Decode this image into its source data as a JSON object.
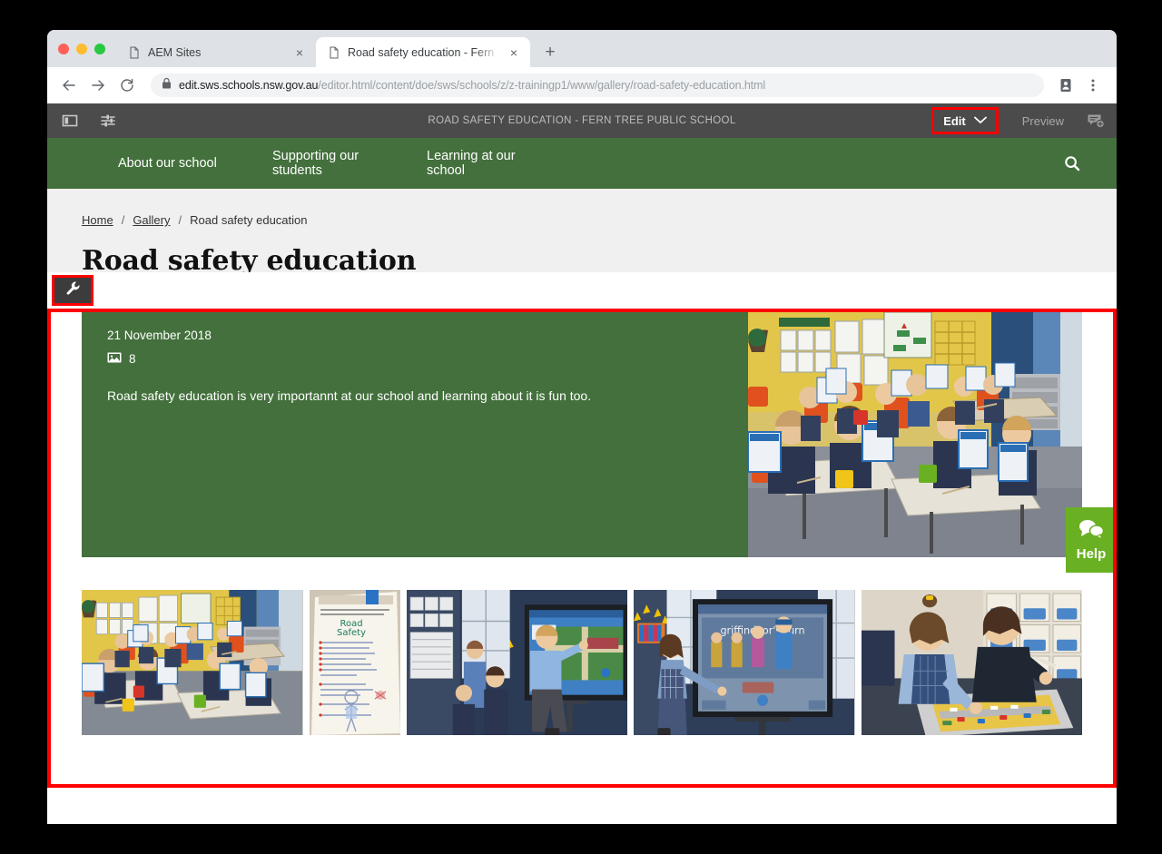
{
  "browser": {
    "tabs": [
      {
        "title": "AEM Sites",
        "active": false,
        "favicon": "page-icon",
        "close": "×"
      },
      {
        "title": "Road safety education - Fern T",
        "active": true,
        "favicon": "page-icon",
        "close": "×"
      }
    ],
    "new_tab_label": "+",
    "back_label": "←",
    "forward_label": "→",
    "reload_label": "C",
    "url_secure_prefix": "https://",
    "url_host": "edit.sws.schools.nsw.gov.au",
    "url_path": "/editor.html/content/doe/sws/schools/z/z-trainingp1/www/gallery/road-safety-education.html",
    "url_full": "https://edit.sws.schools.nsw.gov.au/editor.html/content/doe/sws/schools/z/z-trainingp1/www/gallery/road-safety-education.html",
    "lock_icon": "lock-icon",
    "profile_icon": "profile-card-icon",
    "menu_icon": "kebab-menu-icon"
  },
  "aem_toolbar": {
    "sidebar_toggle_icon": "sidebar-panel-icon",
    "page_info_icon": "page-properties-icon",
    "title": "ROAD SAFETY EDUCATION - FERN TREE PUBLIC SCHOOL",
    "edit_label": "Edit",
    "edit_chevron": "chevron-down-icon",
    "preview_label": "Preview",
    "annotate_icon": "add-annotation-icon",
    "highlight_color": "#ff0000"
  },
  "site_nav": {
    "items": [
      {
        "label": "About our school"
      },
      {
        "label": "Supporting our students"
      },
      {
        "label": "Learning at our school"
      }
    ],
    "search_icon": "search-icon",
    "background": "#43703c"
  },
  "breadcrumb": {
    "items": [
      {
        "label": "Home",
        "link": true
      },
      {
        "label": "Gallery",
        "link": true
      },
      {
        "label": "Road safety education",
        "link": false
      }
    ],
    "separator": "/"
  },
  "page": {
    "title": "Road safety education"
  },
  "component": {
    "wrench_icon": "wrench-icon",
    "selection_color": "#ff0000",
    "edit_bar_color": "#2680eb"
  },
  "gallery": {
    "date": "21 November 2018",
    "image_count": "8",
    "image_count_icon": "image-icon",
    "description": "Road safety education is very importannt at our school and learning about it is fun too.",
    "panel_color": "#43703c",
    "hero_alt": "Students in a classroom holding up road safety worksheets with thumbs up",
    "thumbnails": [
      {
        "alt": "Classroom of students holding road safety worksheets"
      },
      {
        "alt": "Handwritten Road Safety rules poster with drawing"
      },
      {
        "alt": "Boy pointing at interactive whiteboard showing road map"
      },
      {
        "alt": "Girl touching interactive whiteboard with road safety game"
      },
      {
        "alt": "Two students working on a road safety floor mat activity"
      }
    ]
  },
  "help_widget": {
    "label": "Help",
    "icon": "speech-bubbles-icon",
    "color": "#6ab023"
  }
}
